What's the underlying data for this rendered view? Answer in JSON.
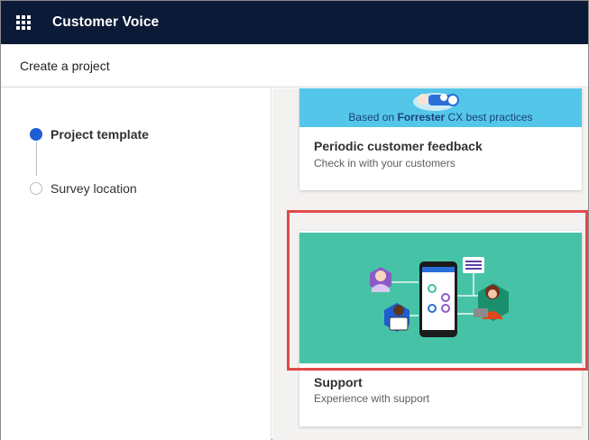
{
  "app": {
    "title": "Customer Voice"
  },
  "subheader": {
    "title": "Create a project"
  },
  "steps": [
    {
      "label": "Project template",
      "state": "active"
    },
    {
      "label": "Survey location",
      "state": "inactive"
    }
  ],
  "cards": [
    {
      "banner_prefix": "Based on",
      "banner_brand": "Forrester",
      "banner_suffix": "CX best practices",
      "title": "Periodic customer feedback",
      "subtitle": "Check in with your customers"
    },
    {
      "title": "Support",
      "subtitle": "Experience with support",
      "highlighted": true
    }
  ],
  "colors": {
    "topbar": "#0b1a36",
    "active_step": "#1e5fd6",
    "card1_banner": "#54c6ea",
    "card2_banner": "#46c3a7",
    "highlight": "#e04a4a"
  },
  "icons": {
    "app_launcher": "waffle-icon"
  }
}
